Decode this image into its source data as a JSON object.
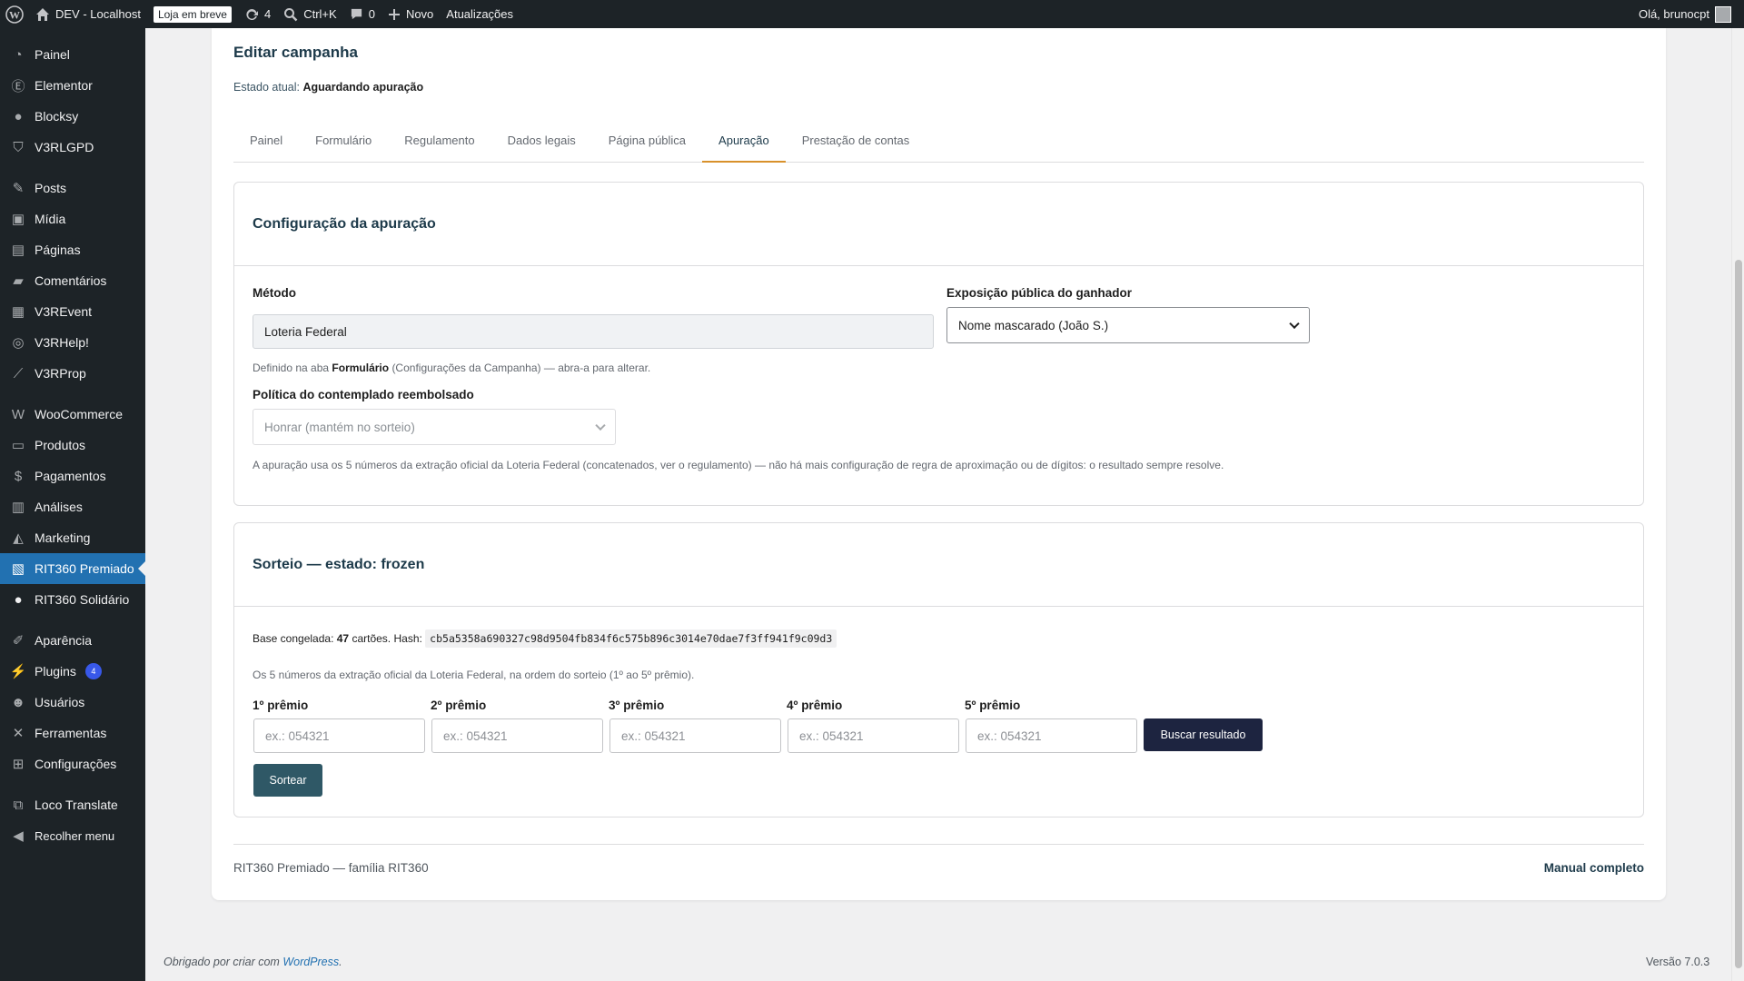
{
  "admin_bar": {
    "site_name": "DEV - Localhost",
    "coming_soon_badge": "Loja em breve",
    "updates_count": "4",
    "search_shortcut": "Ctrl+K",
    "comments_count": "0",
    "new_label": "Novo",
    "updates_label": "Atualizações",
    "greeting": "Olá, brunocpt"
  },
  "sidebar": {
    "items": [
      {
        "label": "Painel",
        "icon": "dashboard-icon"
      },
      {
        "label": "Elementor",
        "icon": "elementor-icon"
      },
      {
        "label": "Blocksy",
        "icon": "blocksy-icon"
      },
      {
        "label": "V3RLGPD",
        "icon": "shield-icon"
      },
      {
        "label": "Posts",
        "icon": "pin-icon"
      },
      {
        "label": "Mídia",
        "icon": "media-icon"
      },
      {
        "label": "Páginas",
        "icon": "pages-icon"
      },
      {
        "label": "Comentários",
        "icon": "comment-icon"
      },
      {
        "label": "V3REvent",
        "icon": "calendar-icon"
      },
      {
        "label": "V3RHelp!",
        "icon": "help-icon"
      },
      {
        "label": "V3RProp",
        "icon": "chart-line-icon"
      },
      {
        "label": "WooCommerce",
        "icon": "woocommerce-icon"
      },
      {
        "label": "Produtos",
        "icon": "archive-icon"
      },
      {
        "label": "Pagamentos",
        "icon": "dollar-icon"
      },
      {
        "label": "Análises",
        "icon": "bar-chart-icon"
      },
      {
        "label": "Marketing",
        "icon": "megaphone-icon"
      },
      {
        "label": "RIT360 Premiado",
        "icon": "tickets-icon"
      },
      {
        "label": "RIT360 Solidário",
        "icon": "circle-icon"
      },
      {
        "label": "Aparência",
        "icon": "brush-icon"
      },
      {
        "label": "Plugins",
        "icon": "plugin-icon",
        "count": "4"
      },
      {
        "label": "Usuários",
        "icon": "user-icon"
      },
      {
        "label": "Ferramentas",
        "icon": "wrench-icon"
      },
      {
        "label": "Configurações",
        "icon": "settings-icon"
      },
      {
        "label": "Loco Translate",
        "icon": "translate-icon"
      },
      {
        "label": "Recolher menu",
        "icon": "collapse-icon"
      }
    ]
  },
  "page": {
    "title": "Editar campanha",
    "state_label": "Estado atual:",
    "state_value": "Aguardando apuração",
    "tabs": [
      "Painel",
      "Formulário",
      "Regulamento",
      "Dados legais",
      "Página pública",
      "Apuração",
      "Prestação de contas"
    ],
    "active_tab": "Apuração"
  },
  "config_panel": {
    "title": "Configuração da apuração",
    "method_label": "Método",
    "method_value": "Loteria Federal",
    "method_hint_prefix": "Definido na aba",
    "method_hint_bold": "Formulário",
    "method_hint_suffix": "(Configurações da Campanha) — abra-a para alterar.",
    "exposure_label": "Exposição pública do ganhador",
    "exposure_value": "Nome mascarado (João S.)",
    "refund_label": "Política do contemplado reembolsado",
    "refund_value": "Honrar (mantém no sorteio)",
    "note": "A apuração usa os 5 números da extração oficial da Loteria Federal (concatenados, ver o regulamento) — não há mais configuração de regra de aproximação ou de dígitos: o resultado sempre resolve."
  },
  "draw_panel": {
    "title": "Sorteio — estado: frozen",
    "base_prefix": "Base congelada:",
    "base_count": "47",
    "base_middle": "cartões. Hash:",
    "hash": "cb5a5358a690327c98d9504fb834f6c575b896c3014e70dae7f3ff941f9c09d3",
    "numbers_hint": "Os 5 números da extração oficial da Loteria Federal, na ordem do sorteio (1º ao 5º prêmio).",
    "prizes": [
      {
        "label": "1º prêmio",
        "placeholder": "ex.: 054321"
      },
      {
        "label": "2º prêmio",
        "placeholder": "ex.: 054321"
      },
      {
        "label": "3º prêmio",
        "placeholder": "ex.: 054321"
      },
      {
        "label": "4º prêmio",
        "placeholder": "ex.: 054321"
      },
      {
        "label": "5º prêmio",
        "placeholder": "ex.: 054321"
      }
    ],
    "search_button": "Buscar resultado",
    "draw_button": "Sortear"
  },
  "card_footer": {
    "left": "RIT360 Premiado — família RIT360",
    "right": "Manual completo"
  },
  "wp_footer": {
    "thanks_prefix": "Obrigado por criar com",
    "thanks_link": "WordPress",
    "thanks_suffix": ".",
    "version": "Versão 7.0.3"
  },
  "colors": {
    "admin_bar": "#1d2327",
    "active_menu": "#2271b1",
    "tab_accent": "#d8912b",
    "heading": "#1d3a4a",
    "search_button": "#1d2440",
    "draw_button": "#2f5866"
  }
}
